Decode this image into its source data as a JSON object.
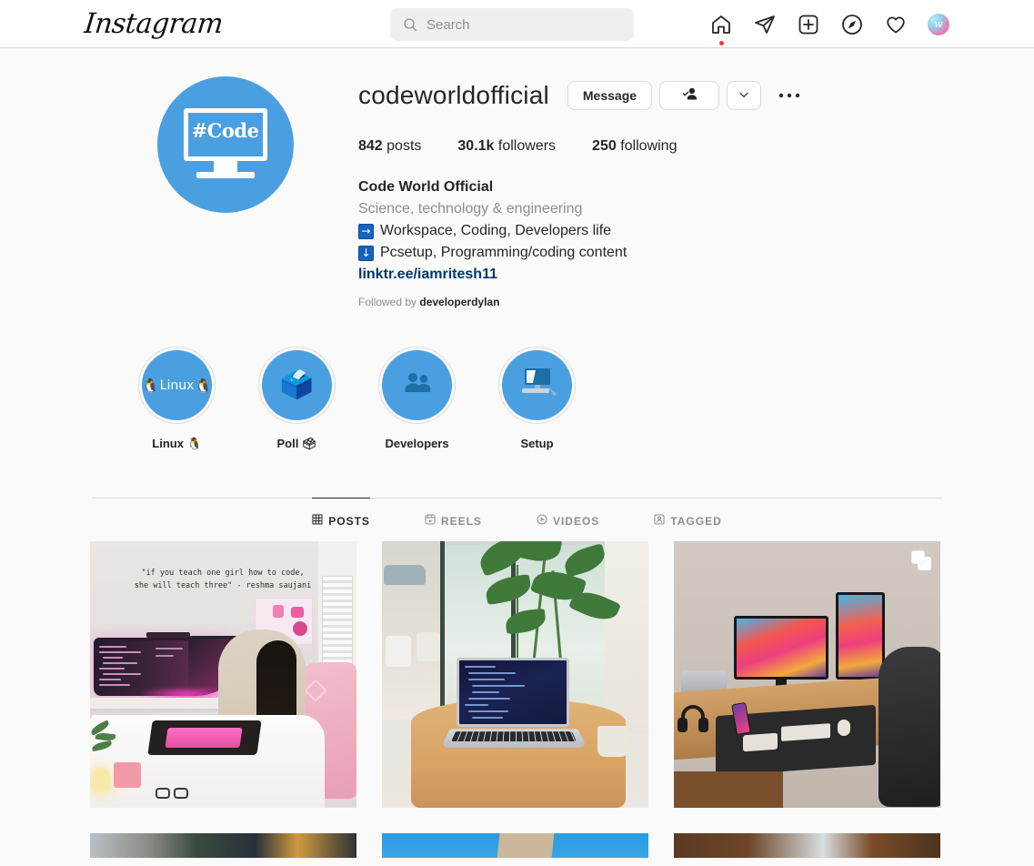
{
  "topbar": {
    "brand": "Instagram",
    "search": {
      "placeholder": "Search",
      "value": "",
      "icon": "search-icon"
    },
    "nav": [
      {
        "name": "home-icon",
        "label": "Home",
        "badge": true
      },
      {
        "name": "messenger-icon",
        "label": "Messages",
        "badge": false
      },
      {
        "name": "new-post-icon",
        "label": "New post",
        "badge": false
      },
      {
        "name": "explore-icon",
        "label": "Explore",
        "badge": false
      },
      {
        "name": "heart-icon",
        "label": "Notifications",
        "badge": false
      },
      {
        "name": "profile-avatar-icon",
        "label": "Profile",
        "badge": false
      }
    ]
  },
  "profile": {
    "avatar": {
      "icon": "monitor-hashcode-avatar",
      "text": "#Code",
      "color": "#4a9fe0"
    },
    "username": "codeworldofficial",
    "actions": {
      "message_label": "Message",
      "following_icon": "person-check-icon",
      "chevron_icon": "chevron-down-icon",
      "options_icon": "ellipsis-icon"
    },
    "stats": {
      "posts_count": "842",
      "posts_label": "posts",
      "followers_count": "30.1k",
      "followers_label": "followers",
      "following_count": "250",
      "following_label": "following"
    },
    "bio": {
      "full_name": "Code World Official",
      "category": "Science, technology & engineering",
      "line1_emoji": "→",
      "line1": "Workspace, Coding, Developers life",
      "line2_emoji": "↓",
      "line2": "Pcsetup, Programming/coding content",
      "link": "linktr.ee/iamritesh11"
    },
    "followed_by_prefix": "Followed by",
    "followed_by_names": "developerdylan"
  },
  "highlights": [
    {
      "label": "Linux 🐧",
      "cover": "linux-penguins",
      "inner_text": "Linux"
    },
    {
      "label": "Poll 🗳",
      "cover": "ballot-box",
      "inner_text": ""
    },
    {
      "label": "Developers",
      "cover": "people-silhouette",
      "inner_text": ""
    },
    {
      "label": "Setup",
      "cover": "desktop-computer",
      "inner_text": ""
    }
  ],
  "tabs": [
    {
      "label": "POSTS",
      "icon": "grid-icon",
      "active": true
    },
    {
      "label": "REELS",
      "icon": "reels-icon",
      "active": false
    },
    {
      "label": "VIDEOS",
      "icon": "play-circle-icon",
      "active": false
    },
    {
      "label": "TAGGED",
      "icon": "tagged-person-icon",
      "active": false
    }
  ],
  "posts": [
    {
      "name": "post-pink-gaming-setup",
      "alt": "Woman coding at pink RGB ultrawide desk setup",
      "overlay_quote_line1": "\"if you teach one girl how to code,",
      "overlay_quote_line2": "she will teach three\" - reshma saujani",
      "is_carousel": false
    },
    {
      "name": "post-laptop-window-plant",
      "alt": "MacBook with code on wooden table beside window and plant",
      "overlay_quote_line1": "",
      "overlay_quote_line2": "",
      "is_carousel": false
    },
    {
      "name": "post-dual-monitor-desk",
      "alt": "Dual monitor macOS Big Sur desk setup with mesh chair",
      "overlay_quote_line1": "",
      "overlay_quote_line2": "",
      "is_carousel": true
    }
  ],
  "posts_partial": [
    {
      "name": "post-dark-interior-partial",
      "alt": "Dark interior workspace"
    },
    {
      "name": "post-blue-sky-building-partial",
      "alt": "Building against blue sky"
    },
    {
      "name": "post-wood-desk-partial",
      "alt": "Wooden desk with device"
    }
  ],
  "colors": {
    "accent_blue": "#4a9fe0",
    "link_blue": "#00376b",
    "muted": "#8e8e8e",
    "border": "#dbdbdb",
    "page_bg": "#fafafa",
    "badge_red": "#ff3040"
  }
}
